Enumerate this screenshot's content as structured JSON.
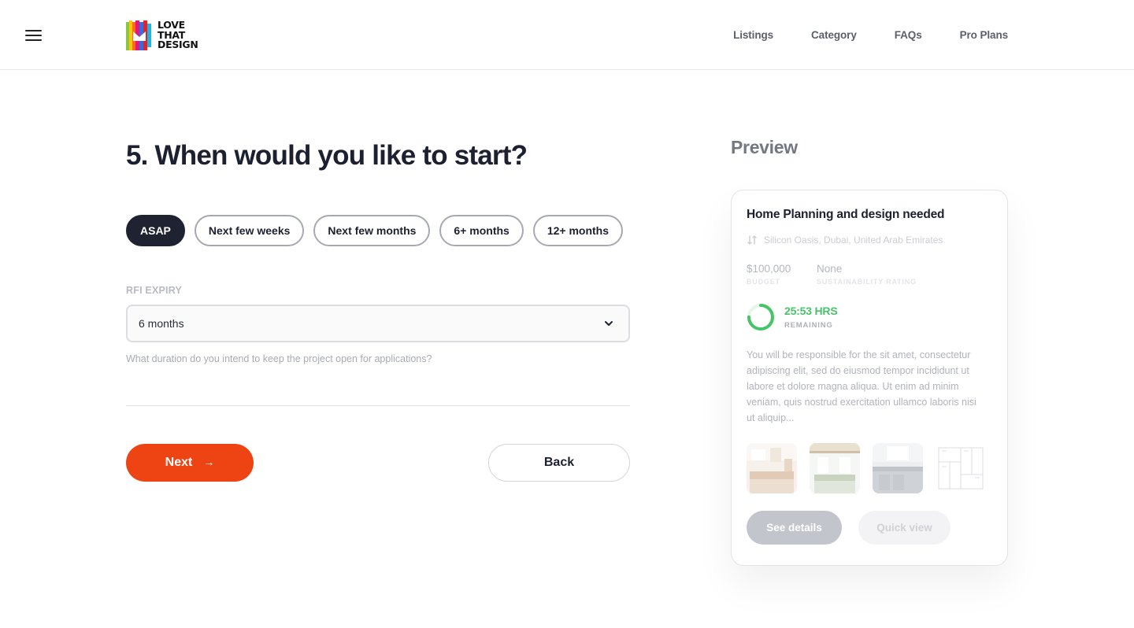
{
  "brand": {
    "logo_lines": [
      "LOVE",
      "THAT",
      "DESIGN"
    ]
  },
  "nav": {
    "items": [
      "Listings",
      "Category",
      "FAQs",
      "Pro Plans"
    ]
  },
  "form": {
    "question": "5. When would you like to start?",
    "options": [
      "ASAP",
      "Next few weeks",
      "Next few months",
      "6+ months",
      "12+ months"
    ],
    "selected_option": "ASAP",
    "rfi_label": "RFI EXPIRY",
    "rfi_value": "6 months",
    "rfi_helper": "What duration do you intend to keep the project open for applications?",
    "next_label": "Next",
    "back_label": "Back"
  },
  "preview": {
    "heading": "Preview",
    "card": {
      "title": "Home Planning and design needed",
      "location": "Silicon Oasis, Dubai, United Arab Emirates",
      "budget_value": "$100,000",
      "budget_label": "BUDGET",
      "rating_value": "None",
      "rating_label": "SUSTAINABILITY RATING",
      "timer_value": "25:53 HRS",
      "timer_label": "REMAINING",
      "timer_progress": 0.75,
      "description": "You will be responsible for the sit amet, consectetur adipiscing elit, sed do eiusmod tempor incididunt ut labore et dolore magna aliqua. Ut enim ad minim veniam, quis nostrud exercitation ullamco laboris nisi ut aliquip...",
      "see_details_label": "See details",
      "quick_view_label": "Quick view"
    }
  },
  "colors": {
    "accent": "#ee4312",
    "dark": "#1f2230",
    "timer_green": "#45c468"
  },
  "icons": [
    "menu-icon",
    "chevron-down-icon",
    "arrow-right-icon",
    "location-swap-icon"
  ]
}
